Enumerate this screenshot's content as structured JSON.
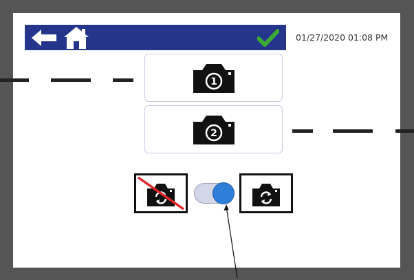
{
  "header": {
    "back_icon": "back-arrow-icon",
    "home_icon": "home-icon",
    "status_icon": "check-icon",
    "status_color": "#3aaa35",
    "datetime": "01/27/2020 01:08 PM",
    "bar_color": "#25358c"
  },
  "cameras": [
    {
      "label": "1",
      "icon": "camera-icon"
    },
    {
      "label": "2",
      "icon": "camera-icon"
    }
  ],
  "rotation_mode": {
    "off_icon": "camera-rotate-disabled-icon",
    "on_icon": "camera-rotate-icon",
    "toggle_state": "on",
    "accent_color": "#2f7ed8"
  }
}
